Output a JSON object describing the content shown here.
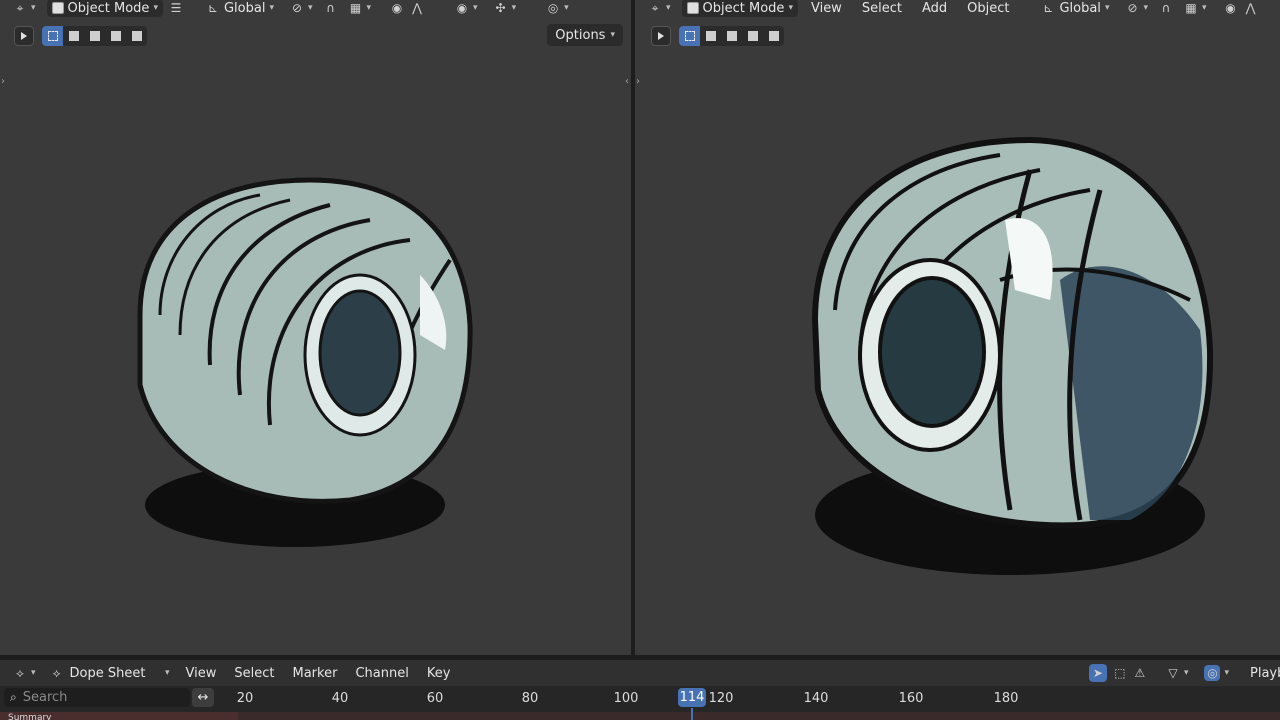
{
  "left_viewport": {
    "header": {
      "editor_type_icon": "viewport-gizmo-icon",
      "mode": {
        "label": "Object Mode",
        "icon": "cube-icon"
      },
      "menu_icon": "hamburger-icon",
      "transform_orientation": {
        "label": "Global",
        "icon": "axes-icon"
      },
      "pivot_icon": "pivot-icon",
      "snap_icon": "magnet-icon",
      "snap_target_icon": "grid-icon",
      "proportional_icon": "proportional-icon",
      "falloff_icon": "falloff-icon",
      "visibility_icon": "eye-icon",
      "gizmo_icon": "gizmo-icon",
      "overlay_icon": "overlay-icon"
    },
    "options_label": "Options"
  },
  "right_viewport": {
    "header": {
      "editor_type_icon": "viewport-gizmo-icon",
      "mode": {
        "label": "Object Mode",
        "icon": "cube-icon"
      },
      "menus": [
        "View",
        "Select",
        "Add",
        "Object"
      ],
      "transform_orientation": {
        "label": "Global",
        "icon": "axes-icon"
      },
      "pivot_icon": "pivot-icon",
      "snap_icon": "magnet-icon",
      "snap_target_icon": "grid-icon",
      "proportional_icon": "proportional-icon",
      "falloff_icon": "falloff-icon"
    }
  },
  "timeline": {
    "editor": {
      "label": "Dope Sheet",
      "icon": "dope-sheet-icon"
    },
    "menus": [
      "View",
      "Select",
      "Marker",
      "Channel",
      "Key"
    ],
    "search_placeholder": "Search",
    "swap_icon": "swap-icon",
    "right_tools": {
      "select_icon": "cursor-select-icon",
      "keyframe_icon": "keyframe-box-icon",
      "warning_icon": "warning-icon",
      "filter_icon": "filter-icon",
      "overlay_icon": "overlay-icon",
      "playback_label": "Playb"
    },
    "frame_ticks": [
      "20",
      "40",
      "60",
      "80",
      "100",
      "120",
      "140",
      "160",
      "180"
    ],
    "current_frame": "114",
    "summary_label": "Summary"
  },
  "colors": {
    "accent": "#4772b3",
    "viewport_bg": "#3a3a3a",
    "tire_body": "#b7c8c4",
    "tire_line": "#111111"
  }
}
